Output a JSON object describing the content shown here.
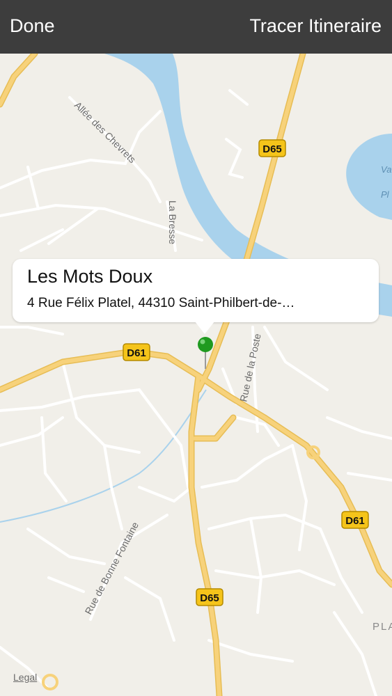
{
  "nav": {
    "done_label": "Done",
    "route_label": "Tracer Itineraire"
  },
  "callout": {
    "title": "Les Mots Doux",
    "address": "4 Rue Félix Platel, 44310 Saint-Philbert-de-…"
  },
  "map": {
    "road_badges": [
      "D65",
      "D61",
      "D61",
      "D65"
    ],
    "street_labels": [
      "Allée des Chevrets",
      "La Bresse",
      "Rue de la Poste",
      "Rue de Bonne Fontaine"
    ],
    "partial_labels": [
      "Va",
      "Pl",
      "PLA"
    ],
    "pin_color": "#1f9a1f",
    "water_color": "#a9d2ec",
    "major_road_color": "#f7d27b"
  },
  "legal_label": "Legal"
}
